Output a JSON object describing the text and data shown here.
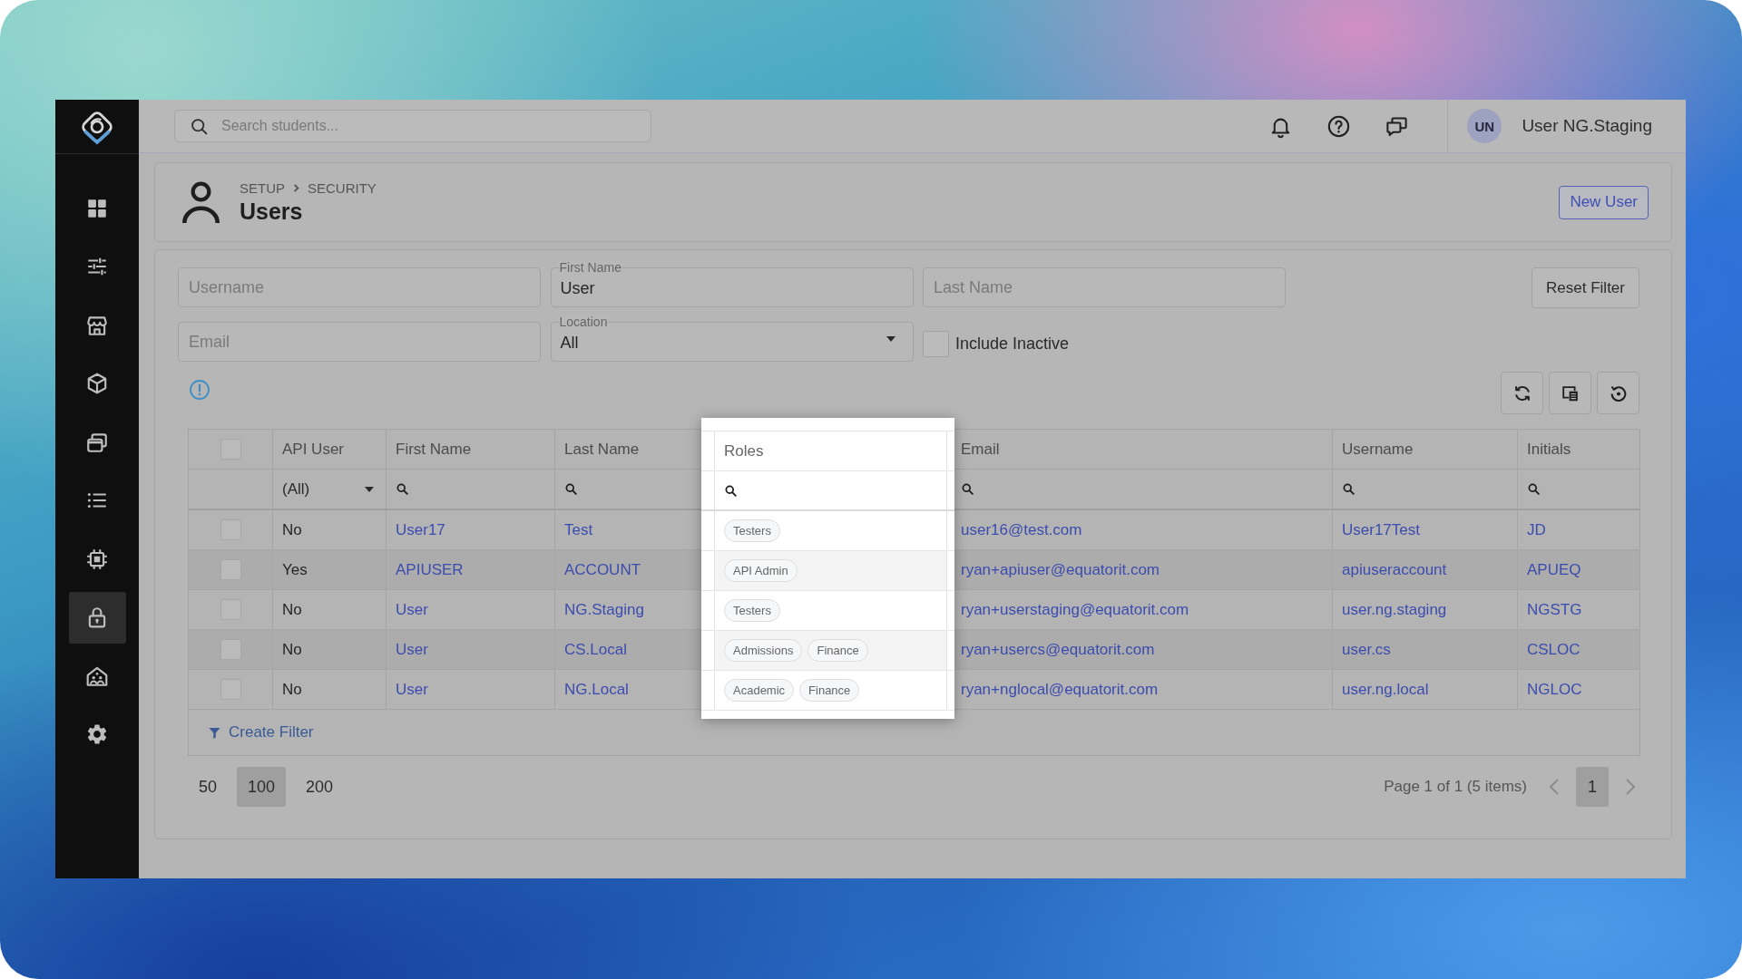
{
  "sidebar": {
    "items": [
      {
        "selected": false
      },
      {
        "selected": false
      },
      {
        "selected": false
      },
      {
        "selected": false
      },
      {
        "selected": false
      },
      {
        "selected": false
      },
      {
        "selected": false
      },
      {
        "selected": true
      },
      {
        "selected": false
      },
      {
        "selected": false
      }
    ]
  },
  "top_bar": {
    "search": {
      "placeholder": "Search students..."
    },
    "user": {
      "initials": "UN",
      "name": "User NG.Staging"
    }
  },
  "page_header": {
    "breadcrumb": [
      "SETUP",
      "SECURITY"
    ],
    "title": "Users",
    "new_button": "New User"
  },
  "filters": {
    "fields": [
      {
        "kind": "text",
        "placeholder": "Username"
      },
      {
        "kind": "text",
        "label": "First Name",
        "value": "User"
      },
      {
        "kind": "text",
        "placeholder": "Last Name"
      },
      {
        "kind": "text",
        "placeholder": "Email"
      },
      {
        "kind": "select",
        "label": "Location",
        "value": "All"
      },
      {
        "kind": "checkbox",
        "label": "Include Inactive",
        "checked": false
      }
    ],
    "reset_button": "Reset Filter"
  },
  "table": {
    "select_all": {
      "checked": false
    },
    "columns": [
      {
        "label": "API User",
        "kind": "text",
        "highlighted": false,
        "filter": {
          "kind": "dropdown",
          "value": "(All)"
        }
      },
      {
        "label": "First Name",
        "kind": "link",
        "highlighted": false,
        "filter": {
          "kind": "search"
        }
      },
      {
        "label": "Last Name",
        "kind": "link",
        "highlighted": false,
        "filter": {
          "kind": "search"
        }
      },
      {
        "label": "Roles",
        "kind": "tags",
        "highlighted": true,
        "filter": {
          "kind": "search"
        }
      },
      {
        "label": "Email",
        "kind": "link",
        "highlighted": false,
        "filter": {
          "kind": "search"
        }
      },
      {
        "label": "Username",
        "kind": "link",
        "highlighted": false,
        "filter": {
          "kind": "search"
        }
      },
      {
        "label": "Initials",
        "kind": "link",
        "highlighted": false,
        "filter": {
          "kind": "search"
        }
      }
    ],
    "rows": [
      {
        "checked": false,
        "cells": [
          "No",
          "User17",
          "Test",
          [
            "Testers"
          ],
          "user16@test.com",
          "User17Test",
          "JD"
        ]
      },
      {
        "checked": false,
        "cells": [
          "Yes",
          "APIUSER",
          "ACCOUNT",
          [
            "API Admin"
          ],
          "ryan+apiuser@equatorit.com",
          "apiuseraccount",
          "APUEQ"
        ]
      },
      {
        "checked": false,
        "cells": [
          "No",
          "User",
          "NG.Staging",
          [
            "Testers"
          ],
          "ryan+userstaging@equatorit.com",
          "user.ng.staging",
          "NGSTG"
        ]
      },
      {
        "checked": false,
        "cells": [
          "No",
          "User",
          "CS.Local",
          [
            "Admissions",
            "Finance"
          ],
          "ryan+usercs@equatorit.com",
          "user.cs",
          "CSLOC"
        ]
      },
      {
        "checked": false,
        "cells": [
          "No",
          "User",
          "NG.Local",
          [
            "Academic",
            "Finance"
          ],
          "ryan+nglocal@equatorit.com",
          "user.ng.local",
          "NGLOC"
        ]
      }
    ],
    "create_filter": "Create Filter"
  },
  "pager": {
    "page_sizes": [
      {
        "label": "50",
        "selected": false
      },
      {
        "label": "100",
        "selected": true
      },
      {
        "label": "200",
        "selected": false
      }
    ],
    "info": "Page 1 of 1 (5 items)",
    "pages": [
      {
        "label": "1",
        "selected": true
      }
    ]
  }
}
